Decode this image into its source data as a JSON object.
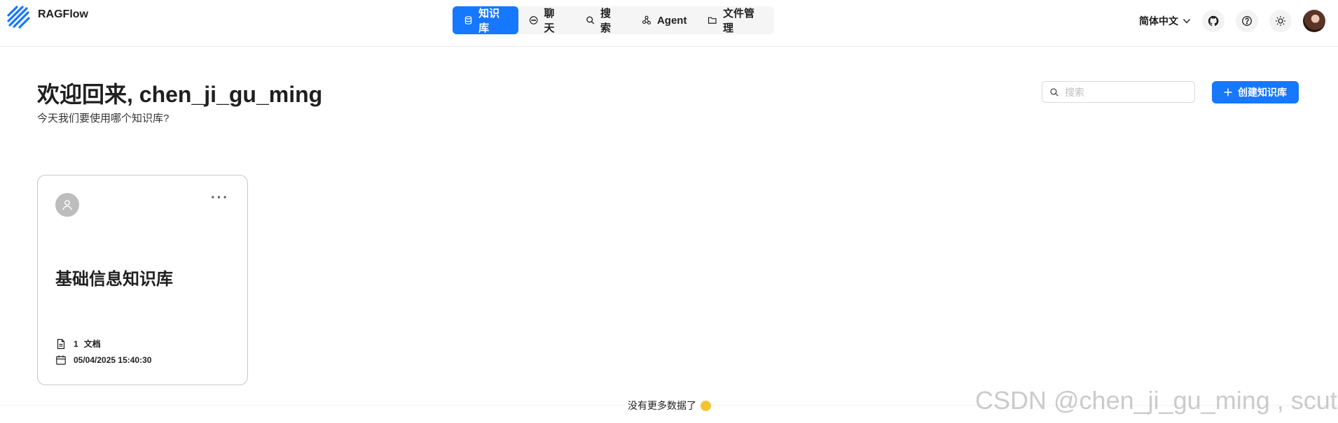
{
  "app": {
    "name": "RAGFlow"
  },
  "nav": {
    "items": [
      {
        "label": "知识库",
        "icon": "database-icon",
        "active": true
      },
      {
        "label": "聊天",
        "icon": "chat-icon",
        "active": false
      },
      {
        "label": "搜索",
        "icon": "search-icon",
        "active": false
      },
      {
        "label": "Agent",
        "icon": "agent-graph-icon",
        "active": false
      },
      {
        "label": "文件管理",
        "icon": "folder-icon",
        "active": false
      }
    ]
  },
  "header": {
    "language": "简体中文",
    "tools": [
      "github-icon",
      "help-icon",
      "theme-sun-icon",
      "user-avatar"
    ]
  },
  "welcome": {
    "title": "欢迎回来, chen_ji_gu_ming",
    "subtitle": "今天我们要使用哪个知识库?"
  },
  "search": {
    "placeholder": "搜索",
    "value": ""
  },
  "create_button": {
    "label": "创建知识库"
  },
  "knowledge_bases": [
    {
      "name": "基础信息知识库",
      "doc_count": "1",
      "doc_unit": "文档",
      "updated": "05/04/2025 15:40:30"
    }
  ],
  "footer": {
    "no_more": "没有更多数据了"
  },
  "watermark": "CSDN @chen_ji_gu_ming , scut",
  "colors": {
    "primary": "#1677ff",
    "nav_bg": "#f5f5f5",
    "card_border": "#c9c9c9"
  }
}
